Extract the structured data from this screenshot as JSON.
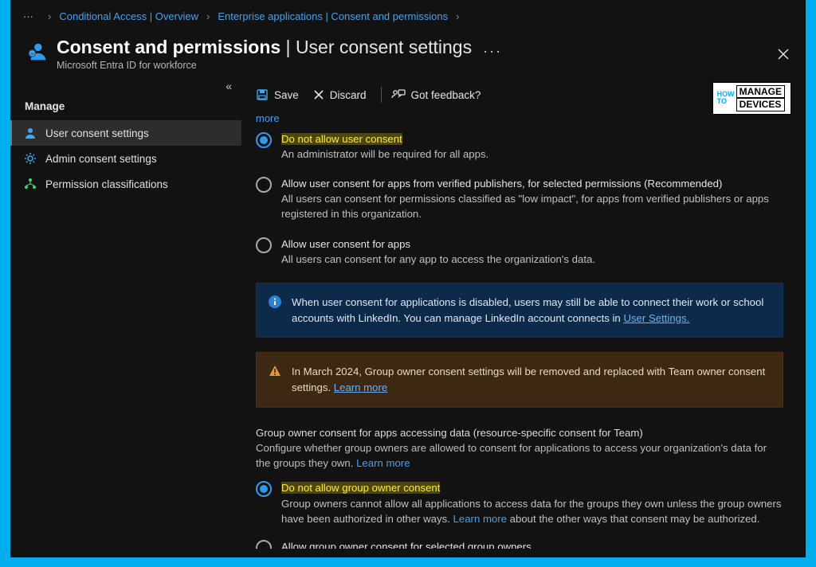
{
  "breadcrumb": {
    "ellipsis": "···",
    "items": [
      "Conditional Access | Overview",
      "Enterprise applications | Consent and permissions"
    ]
  },
  "header": {
    "title_strong": "Consent and permissions",
    "title_sep": " | ",
    "title_thin": "User consent settings",
    "subtitle": "Microsoft Entra ID for workforce",
    "more": "···"
  },
  "sidebar": {
    "collapse": "«",
    "heading": "Manage",
    "items": [
      {
        "label": "User consent settings",
        "icon": "person-icon",
        "active": true
      },
      {
        "label": "Admin consent settings",
        "icon": "gear-icon",
        "active": false
      },
      {
        "label": "Permission classifications",
        "icon": "hierarchy-icon",
        "active": false
      }
    ]
  },
  "toolbar": {
    "save": "Save",
    "discard": "Discard",
    "feedback": "Got feedback?"
  },
  "brand": {
    "line1a": "HOW",
    "line1b": "MANAGE",
    "line2a": "TO",
    "line2b": "DEVICES"
  },
  "content": {
    "more": "more",
    "options_user": [
      {
        "title": "Do not allow user consent",
        "desc": "An administrator will be required for all apps.",
        "selected": true,
        "highlight": true
      },
      {
        "title": "Allow user consent for apps from verified publishers, for selected permissions (Recommended)",
        "desc": "All users can consent for permissions classified as \"low impact\", for apps from verified publishers or apps registered in this organization.",
        "selected": false
      },
      {
        "title": "Allow user consent for apps",
        "desc": "All users can consent for any app to access the organization's data.",
        "selected": false
      }
    ],
    "banner_info": {
      "text_pre": "When user consent for applications is disabled, users may still be able to connect their work or school accounts with LinkedIn. You can manage LinkedIn account connects in ",
      "link": "User Settings."
    },
    "banner_warn": {
      "text": "In March 2024, Group owner consent settings will be removed and replaced with Team owner consent settings. ",
      "link": "Learn more"
    },
    "group_section": {
      "title": "Group owner consent for apps accessing data (resource-specific consent for Team)",
      "desc": "Configure whether group owners are allowed to consent for applications to access your organization's data for the groups they own. ",
      "learn_more": "Learn more"
    },
    "options_group": [
      {
        "title": "Do not allow group owner consent",
        "desc_pre": "Group owners cannot allow all applications to access data for the groups they own unless the group owners have been authorized in other ways. ",
        "link": "Learn more",
        "desc_post": " about the other ways that consent may be authorized.",
        "selected": true,
        "highlight": true
      },
      {
        "title": "Allow group owner consent for selected group owners",
        "desc_pre": "",
        "link": "",
        "desc_post": "",
        "selected": false
      }
    ]
  }
}
